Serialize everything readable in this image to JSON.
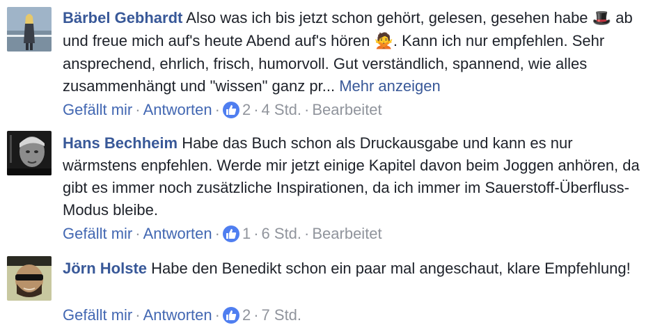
{
  "colors": {
    "author": "#385898",
    "action_link": "#4267b2",
    "muted": "#90949c",
    "like_badge": "#4f7ef0"
  },
  "comments": [
    {
      "author": "Bärbel Gebhardt",
      "text_part1": "Also was ich bis jetzt schon gehört, gelesen, gesehen habe",
      "emoji1": "🎩",
      "text_part2": "ab und freue mich auf's heute Abend auf's hören",
      "emoji2": "🙅",
      "text_part3": ". Kann ich nur empfehlen. Sehr ansprechend, ehrlich, frisch, humorvoll. Gut verständlich, spannend, wie alles zusammenhängt und \"wissen\" ganz pr...",
      "more_label": "Mehr anzeigen",
      "like_label": "Gefällt mir",
      "reply_label": "Antworten",
      "like_count": "2",
      "time": "4 Std.",
      "edited": "Bearbeitet"
    },
    {
      "author": "Hans Bechheim",
      "text": "Habe das Buch schon als Druckausgabe und kann es nur wärmstens enpfehlen. Werde mir jetzt einige Kapitel davon beim Joggen anhören, da gibt es immer noch zusätzliche Inspirationen, da ich immer im Sauerstoff-Überfluss-Modus bleibe.",
      "like_label": "Gefällt mir",
      "reply_label": "Antworten",
      "like_count": "1",
      "time": "6 Std.",
      "edited": "Bearbeitet"
    },
    {
      "author": "Jörn Holste",
      "text": "Habe den Benedikt schon ein paar mal angeschaut, klare Empfehlung!",
      "like_label": "Gefällt mir",
      "reply_label": "Antworten",
      "like_count": "2",
      "time": "7 Std."
    }
  ]
}
